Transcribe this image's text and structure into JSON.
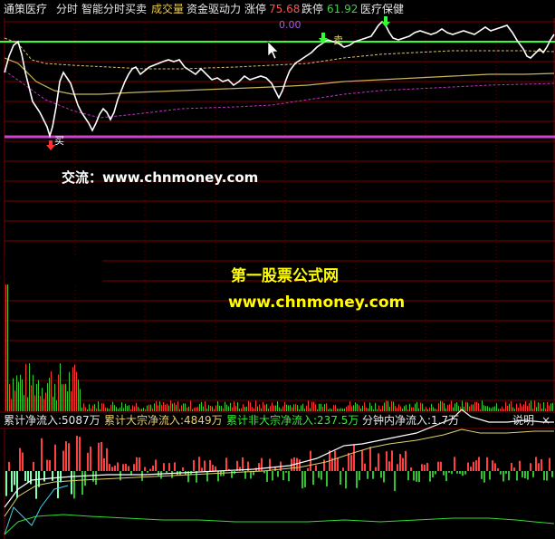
{
  "header": {
    "stock_name": "通策医疗",
    "period": "分时",
    "indicator_1": "智能分时买卖",
    "indicator_2": "成交量",
    "indicator_3": "资金驱动力",
    "limit_up_label": "涨停",
    "limit_up_value": "75.68",
    "limit_down_label": "跌停",
    "limit_down_value": "61.92",
    "sector": "医疗保健"
  },
  "main_chart": {
    "zero_label": "0.00",
    "buy_label": "买",
    "sell_label": "卖"
  },
  "watermark": {
    "contact": "交流：www.chnmoney.com",
    "site_name": "第一股票公式网",
    "site_url": "www.chnmoney.com"
  },
  "sub_panel": {
    "cumulative_net_inflow": "累计净流入:5087万",
    "cumulative_block_inflow": "累计大宗净流入:4849万",
    "cumulative_nonblock_inflow": "累计非大宗净流入:237.5万",
    "minute_net_inflow": "分钟内净流入:1.7万",
    "help_label": "说明",
    "close_glyph": "×"
  },
  "colors": {
    "background": "#000000",
    "grid_red": "#8b0000",
    "bright_green": "#33ff33",
    "price_white": "#ffffff",
    "avg_yellow": "#c8b45a",
    "magenta": "#c030c0",
    "watermark_yellow": "#ffff00"
  }
}
